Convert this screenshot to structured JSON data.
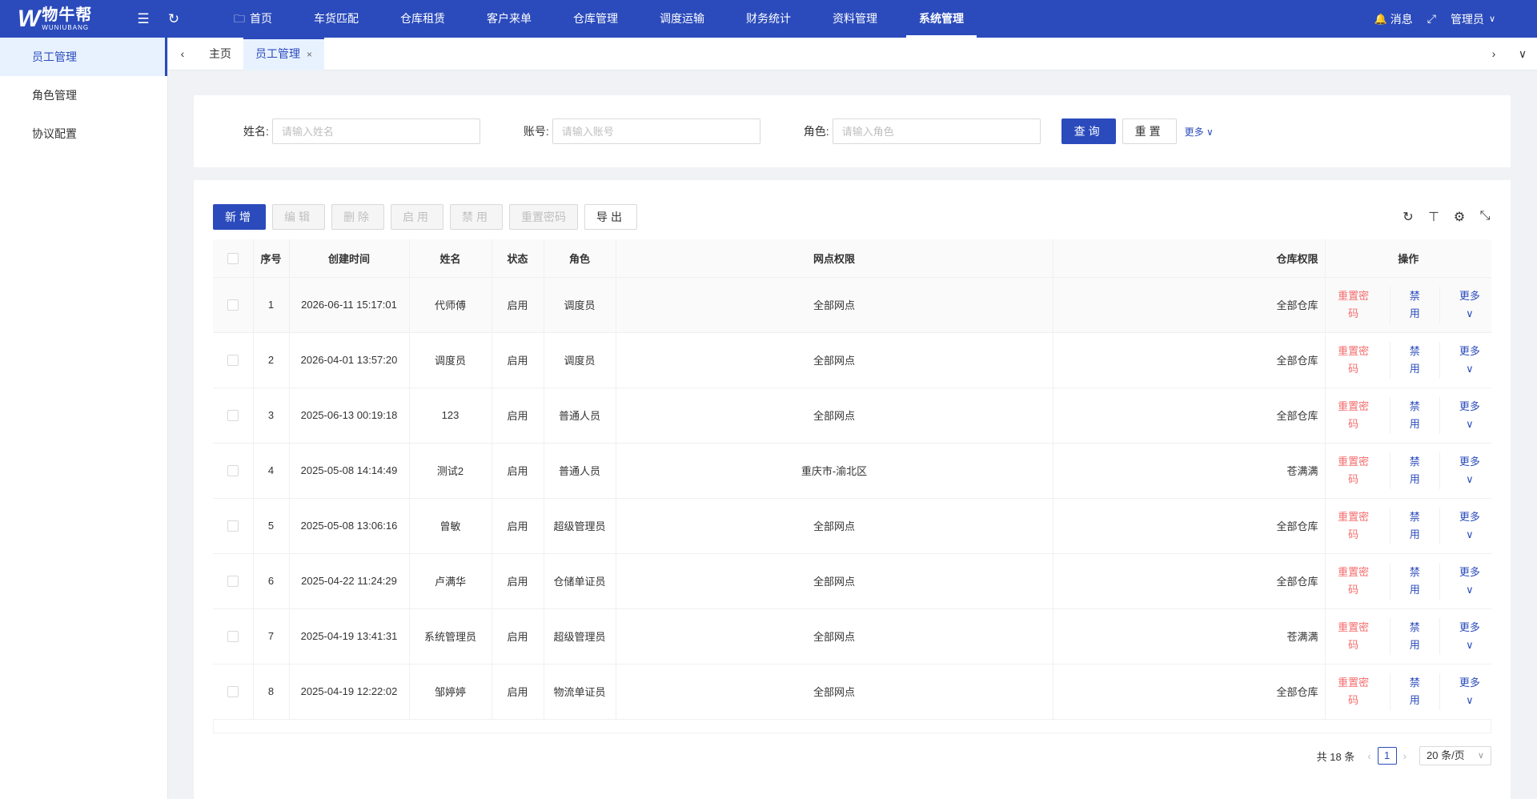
{
  "app": {
    "logo_mark": "W",
    "logo_cn": "物牛帮",
    "logo_en": "WUNIUBANG"
  },
  "topnav": {
    "items": [
      {
        "label": "首页"
      },
      {
        "label": "车货匹配"
      },
      {
        "label": "仓库租赁"
      },
      {
        "label": "客户来单"
      },
      {
        "label": "仓库管理"
      },
      {
        "label": "调度运输"
      },
      {
        "label": "财务统计"
      },
      {
        "label": "资料管理"
      },
      {
        "label": "系统管理"
      }
    ],
    "active": "系统管理",
    "message_label": "消息",
    "user_label": "管理员"
  },
  "sidebar": {
    "items": [
      {
        "label": "员工管理"
      },
      {
        "label": "角色管理"
      },
      {
        "label": "协议配置"
      }
    ]
  },
  "tabs": {
    "items": [
      {
        "label": "主页"
      },
      {
        "label": "员工管理"
      }
    ]
  },
  "search": {
    "name_label": "姓名:",
    "name_placeholder": "请输入姓名",
    "account_label": "账号:",
    "account_placeholder": "请输入账号",
    "role_label": "角色:",
    "role_placeholder": "请输入角色",
    "query_label": "查询",
    "reset_label": "重置",
    "more_label": "更多"
  },
  "toolbar": {
    "add": "新增",
    "edit": "编辑",
    "delete": "删除",
    "enable": "启用",
    "disable": "禁用",
    "reset_pwd": "重置密码",
    "export": "导出"
  },
  "table": {
    "headers": {
      "index": "序号",
      "created": "创建时间",
      "name": "姓名",
      "status": "状态",
      "role": "角色",
      "network": "网点权限",
      "warehouse": "仓库权限",
      "actions": "操作"
    },
    "rows": [
      {
        "index": "1",
        "created": "2026-06-11 15:17:01",
        "name": "代师傅",
        "status": "启用",
        "role": "调度员",
        "network": "全部网点",
        "warehouse": "全部仓库"
      },
      {
        "index": "2",
        "created": "2026-04-01 13:57:20",
        "name": "调度员",
        "status": "启用",
        "role": "调度员",
        "network": "全部网点",
        "warehouse": "全部仓库"
      },
      {
        "index": "3",
        "created": "2025-06-13 00:19:18",
        "name": "123",
        "status": "启用",
        "role": "普通人员",
        "network": "全部网点",
        "warehouse": "全部仓库"
      },
      {
        "index": "4",
        "created": "2025-05-08 14:14:49",
        "name": "测试2",
        "status": "启用",
        "role": "普通人员",
        "network": "重庆市-渝北区",
        "warehouse": "苍满满"
      },
      {
        "index": "5",
        "created": "2025-05-08 13:06:16",
        "name": "曾敏",
        "status": "启用",
        "role": "超级管理员",
        "network": "全部网点",
        "warehouse": "全部仓库"
      },
      {
        "index": "6",
        "created": "2025-04-22 11:24:29",
        "name": "卢满华",
        "status": "启用",
        "role": "仓储单证员",
        "network": "全部网点",
        "warehouse": "全部仓库"
      },
      {
        "index": "7",
        "created": "2025-04-19 13:41:31",
        "name": "系统管理员",
        "status": "启用",
        "role": "超级管理员",
        "network": "全部网点",
        "warehouse": "苍满满"
      },
      {
        "index": "8",
        "created": "2025-04-19 12:22:02",
        "name": "邹婷婷",
        "status": "启用",
        "role": "物流单证员",
        "network": "全部网点",
        "warehouse": "全部仓库"
      }
    ],
    "row_actions": {
      "reset_line1": "重置密",
      "reset_line2": "码",
      "disable_line1": "禁",
      "disable_line2": "用",
      "more": "更多"
    }
  },
  "pagination": {
    "total_text": "共 18 条",
    "current_page": "1",
    "page_size": "20 条/页"
  },
  "colors": {
    "primary": "#2b4bbc",
    "danger": "#f56c6c"
  }
}
